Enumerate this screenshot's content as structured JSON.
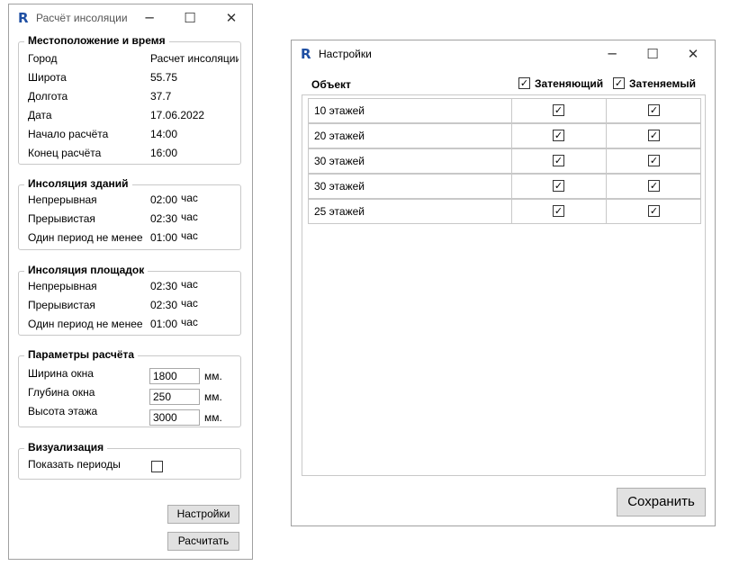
{
  "left_window": {
    "title": "Расчёт инсоляции",
    "location": {
      "header": "Местоположение и время",
      "rows": [
        {
          "label": "Город",
          "value": "Расчет инсоляции"
        },
        {
          "label": "Широта",
          "value": "55.75"
        },
        {
          "label": "Долгота",
          "value": "37.7"
        },
        {
          "label": "Дата",
          "value": "17.06.2022"
        },
        {
          "label": "Начало расчёта",
          "value": "14:00"
        },
        {
          "label": "Конец расчёта",
          "value": "16:00"
        }
      ]
    },
    "buildings": {
      "header": "Инсоляция зданий",
      "rows": [
        {
          "label": "Непрерывная",
          "value": "02:00",
          "unit": "час"
        },
        {
          "label": "Прерывистая",
          "value": "02:30",
          "unit": "час"
        },
        {
          "label": "Один период не менее",
          "value": "01:00",
          "unit": "час"
        }
      ]
    },
    "grounds": {
      "header": "Инсоляция площадок",
      "rows": [
        {
          "label": "Непрерывная",
          "value": "02:30",
          "unit": "час"
        },
        {
          "label": "Прерывистая",
          "value": "02:30",
          "unit": "час"
        },
        {
          "label": "Один период не менее",
          "value": "01:00",
          "unit": "час"
        }
      ]
    },
    "params": {
      "header": "Параметры расчёта",
      "rows": [
        {
          "label": "Ширина окна",
          "value": "1800",
          "unit": "мм."
        },
        {
          "label": "Глубина окна",
          "value": "250",
          "unit": "мм."
        },
        {
          "label": "Высота этажа",
          "value": "3000",
          "unit": "мм."
        }
      ]
    },
    "visual": {
      "header": "Визуализация",
      "show_periods_label": "Показать периоды",
      "show_periods_checked": false
    },
    "settings_button": "Настройки",
    "calculate_button": "Расчитать"
  },
  "right_window": {
    "title": "Настройки",
    "columns": {
      "object": "Объект",
      "shading": "Затеняющий",
      "shaded": "Затеняемый"
    },
    "header_shading_checked": true,
    "header_shaded_checked": true,
    "rows": [
      {
        "name": "10 этажей",
        "shading": true,
        "shaded": true
      },
      {
        "name": "20 этажей",
        "shading": true,
        "shaded": true
      },
      {
        "name": "30 этажей",
        "shading": true,
        "shaded": true
      },
      {
        "name": "30 этажей",
        "shading": true,
        "shaded": true
      },
      {
        "name": "25 этажей",
        "shading": true,
        "shaded": true
      }
    ],
    "save_button": "Сохранить"
  },
  "icons": {
    "app_logo": "revit-r-icon",
    "minimize": "minimize-icon",
    "maximize": "maximize-icon",
    "close": "close-icon",
    "check": "check-icon"
  }
}
